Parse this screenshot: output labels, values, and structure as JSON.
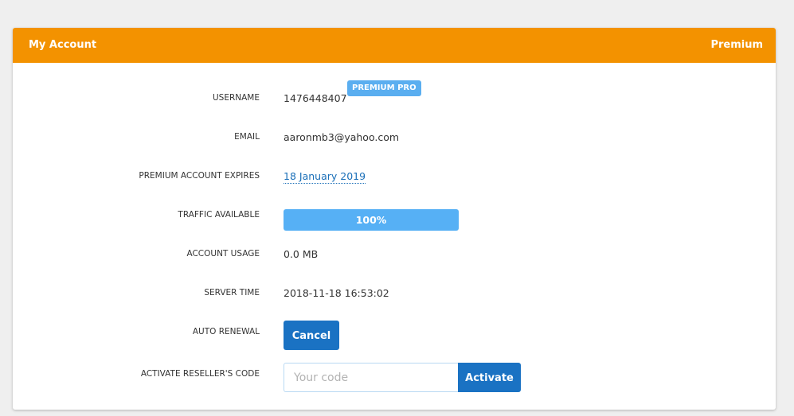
{
  "header": {
    "title": "My Account",
    "plan": "Premium"
  },
  "account": {
    "username_label": "USERNAME",
    "username": "1476448407",
    "badge": "PREMIUM PRO",
    "email_label": "EMAIL",
    "email": "aaronmb3@yahoo.com",
    "expires_label": "PREMIUM ACCOUNT EXPIRES",
    "expires": "18 January 2019",
    "traffic_label": "TRAFFIC AVAILABLE",
    "traffic_percent": 100,
    "traffic_text": "100%",
    "usage_label": "ACCOUNT USAGE",
    "usage": "0.0 MB",
    "server_time_label": "SERVER TIME",
    "server_time": "2018-11-18 16:53:02",
    "auto_renewal_label": "AUTO RENEWAL",
    "cancel_label": "Cancel",
    "reseller_label": "ACTIVATE RESELLER'S CODE",
    "code_placeholder": "Your code",
    "code_value": "",
    "activate_label": "Activate"
  },
  "colors": {
    "header_bg": "#f39200",
    "badge_bg": "#5aaef0",
    "progress_fill": "#56b0f5",
    "button_bg": "#1a72c3",
    "link": "#1a6fb8"
  }
}
